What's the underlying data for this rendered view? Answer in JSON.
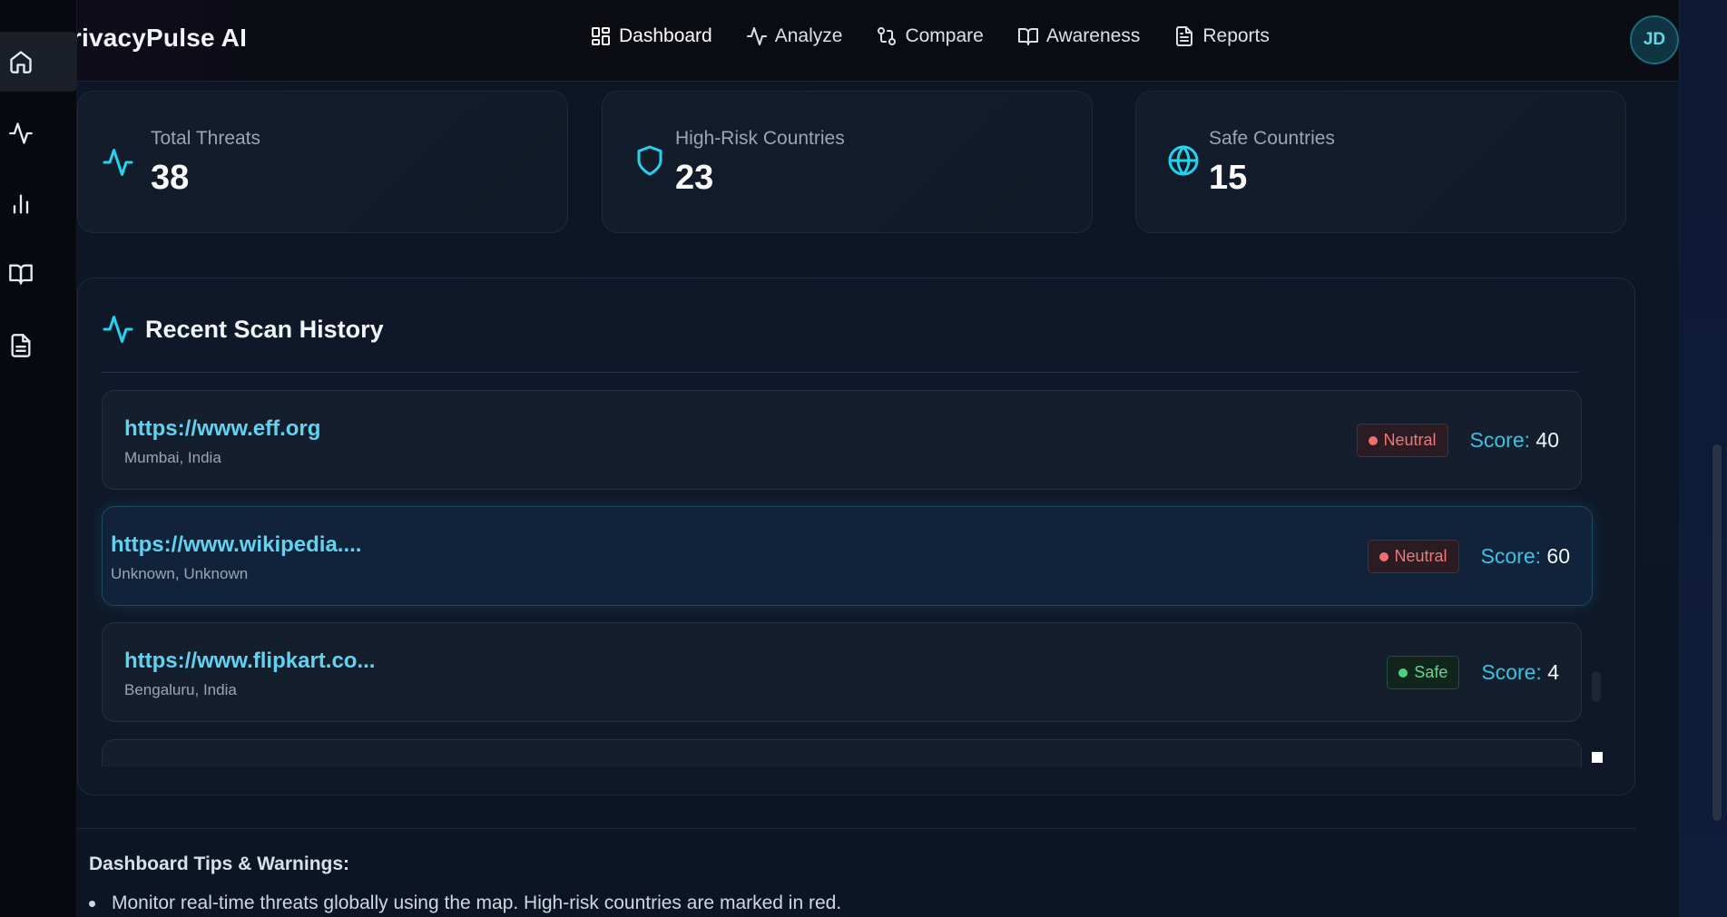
{
  "app": {
    "brand": "PrivacyPulse AI",
    "user_initials": "JD",
    "accent": "#22d3ee"
  },
  "nav": {
    "items": [
      {
        "label": "Dashboard",
        "icon": "dashboard-icon"
      },
      {
        "label": "Analyze",
        "icon": "activity-icon"
      },
      {
        "label": "Compare",
        "icon": "compare-icon"
      },
      {
        "label": "Awareness",
        "icon": "book-icon"
      },
      {
        "label": "Reports",
        "icon": "file-text-icon"
      }
    ],
    "active": "Dashboard"
  },
  "sidebar": {
    "icons": [
      "home-icon",
      "activity-icon",
      "bar-chart-icon",
      "book-icon",
      "file-text-icon"
    ]
  },
  "stats": [
    {
      "label": "Total Threats",
      "value": "38",
      "icon": "activity-icon"
    },
    {
      "label": "High-Risk Countries",
      "value": "23",
      "icon": "shield-icon"
    },
    {
      "label": "Safe Countries",
      "value": "15",
      "icon": "globe-icon"
    }
  ],
  "history": {
    "title": "Recent Scan History",
    "score_label": "Score:",
    "rows": [
      {
        "url": "https://www.eff.org",
        "location": "Mumbai, India",
        "status": "Neutral",
        "score": "40"
      },
      {
        "url": "https://www.wikipedia....",
        "location": "Unknown, Unknown",
        "status": "Neutral",
        "score": "60"
      },
      {
        "url": "https://www.flipkart.co...",
        "location": "Bengaluru, India",
        "status": "Safe",
        "score": "4"
      }
    ]
  },
  "tips": {
    "title": "Dashboard Tips & Warnings:",
    "items": [
      "Monitor real-time threats globally using the map. High-risk countries are marked in red."
    ]
  }
}
